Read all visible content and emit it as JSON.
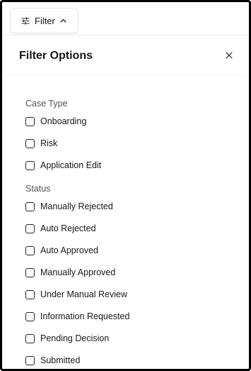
{
  "filter_button": {
    "label": "Filter",
    "expanded": true
  },
  "panel": {
    "title": "Filter Options",
    "sections": [
      {
        "title": "Case Type",
        "options": [
          {
            "label": "Onboarding",
            "checked": false
          },
          {
            "label": "Risk",
            "checked": false
          },
          {
            "label": "Application Edit",
            "checked": false
          }
        ]
      },
      {
        "title": "Status",
        "options": [
          {
            "label": "Manually Rejected",
            "checked": false
          },
          {
            "label": "Auto Rejected",
            "checked": false
          },
          {
            "label": "Auto Approved",
            "checked": false
          },
          {
            "label": "Manually Approved",
            "checked": false
          },
          {
            "label": "Under Manual Review",
            "checked": false
          },
          {
            "label": "Information Requested",
            "checked": false
          },
          {
            "label": "Pending Decision",
            "checked": false
          },
          {
            "label": "Submitted",
            "checked": false
          }
        ]
      }
    ]
  },
  "icons": {
    "filter_button": [
      "sliders-icon",
      "chevron-up-icon"
    ],
    "panel": [
      "close-icon"
    ]
  }
}
